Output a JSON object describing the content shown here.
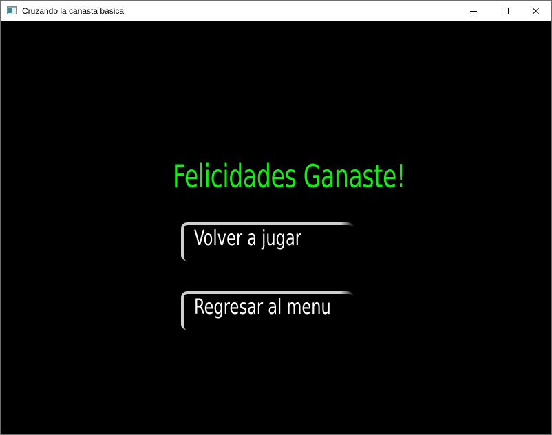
{
  "window": {
    "title": "Cruzando la canasta basica",
    "app_icon": "window-app-icon",
    "controls": {
      "minimize": "minimize-icon",
      "maximize": "maximize-icon",
      "close": "close-icon"
    }
  },
  "screen": {
    "message": "Felicidades Ganaste!",
    "buttons": [
      {
        "label": "Volver a jugar"
      },
      {
        "label": "Regresar al menu"
      }
    ]
  },
  "colors": {
    "background": "#000000",
    "message": "#11ee11",
    "button_text": "#ffffff",
    "button_frame": "#cfcfcf"
  }
}
